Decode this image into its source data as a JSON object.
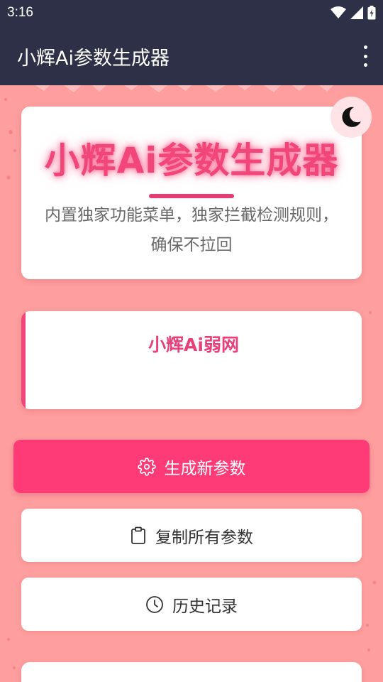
{
  "status_bar": {
    "time": "3:16"
  },
  "app_bar": {
    "title": "小辉Ai参数生成器"
  },
  "hero": {
    "title": "小辉Ai参数生成器",
    "description": "内置独家功能菜单，独家拦截检测规则，确保不拉回"
  },
  "network_card": {
    "title": "小辉Ai弱网"
  },
  "actions": {
    "generate_label": "生成新参数",
    "copy_label": "复制所有参数",
    "history_label": "历史记录"
  },
  "icons": {
    "status": [
      "wifi-icon",
      "signal-icon",
      "battery-icon"
    ],
    "menu": "more-vert-icon",
    "theme": "moon-icon",
    "generate": "gear-icon",
    "copy": "clipboard-icon",
    "history": "clock-icon"
  },
  "colors": {
    "app_bar": "#2e3047",
    "background": "#ff9e9e",
    "accent": "#fe3b77",
    "title_pink": "#f0467a"
  }
}
